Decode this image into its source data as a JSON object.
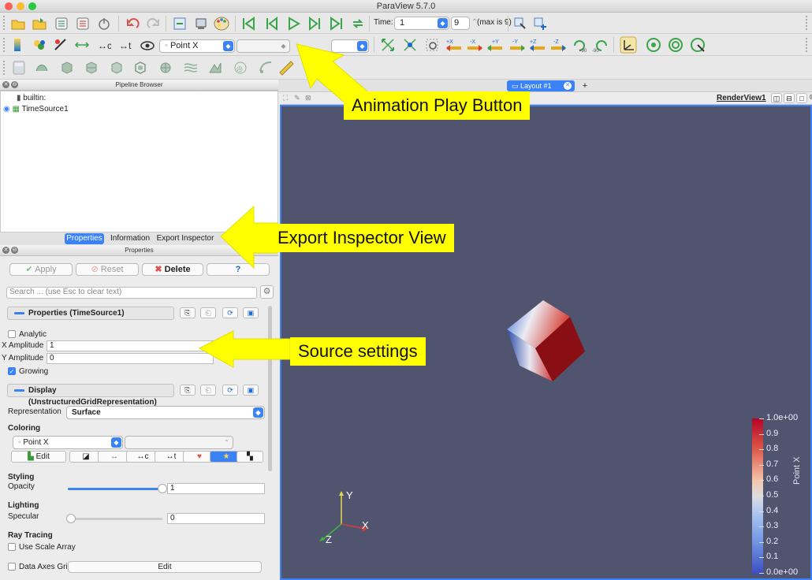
{
  "window": {
    "title": "ParaView 5.7.0"
  },
  "time": {
    "label": "Time:",
    "value": "1",
    "index": "9",
    "max_text": "(max is 9)"
  },
  "toolbar2": {
    "color_array": "Point X"
  },
  "pipeline": {
    "title": "Pipeline Browser",
    "root": "builtin:",
    "source": "TimeSource1"
  },
  "tabs": {
    "properties": "Properties",
    "information": "Information",
    "export": "Export Inspector"
  },
  "properties": {
    "title": "Properties",
    "apply": "Apply",
    "reset": "Reset",
    "delete": "Delete",
    "help": "?",
    "search_placeholder": "Search ... (use Esc to clear text)",
    "section_props": "Properties (TimeSource1)",
    "analytic": "Analytic",
    "x_amplitude_label": "X Amplitude",
    "x_amplitude": "1",
    "y_amplitude_label": "Y Amplitude",
    "y_amplitude": "0",
    "growing": "Growing",
    "section_display": "Display (UnstructuredGridRepresentation)",
    "representation_label": "Representation",
    "representation": "Surface",
    "coloring_label": "Coloring",
    "coloring": "Point X",
    "edit": "Edit",
    "styling_label": "Styling",
    "opacity_label": "Opacity",
    "opacity": "1",
    "opacity_level": 1.0,
    "lighting_label": "Lighting",
    "specular_label": "Specular",
    "specular": "0",
    "specular_level": 0.0,
    "raytracing_label": "Ray Tracing",
    "use_scale_array": "Use Scale Array",
    "data_axes_grid": "Data Axes Grid",
    "data_axes_edit": "Edit"
  },
  "layout": {
    "tab": "Layout #1",
    "plus": "+",
    "view_name": "RenderView1"
  },
  "colorbar": {
    "title": "Point X",
    "ticks": [
      "1.0e+00",
      "0.9",
      "0.8",
      "0.7",
      "0.6",
      "0.5",
      "0.4",
      "0.3",
      "0.2",
      "0.1",
      "0.0e+00"
    ]
  },
  "axes": {
    "x": "X",
    "y": "Y",
    "z": "Z"
  },
  "annotations": {
    "play": "Animation Play Button",
    "export": "Export Inspector View",
    "source": "Source settings"
  },
  "colors": {
    "view_bg": "#51546e",
    "accent": "#3b82f6",
    "callout": "#ffff00"
  }
}
